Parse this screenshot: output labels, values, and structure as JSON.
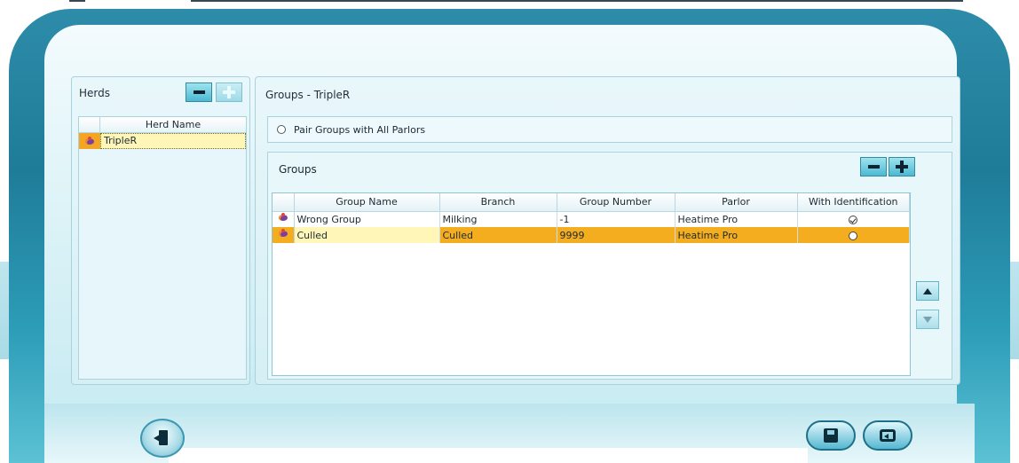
{
  "herds": {
    "title": "Herds",
    "remove_icon": "minus-icon",
    "add_icon": "plus-icon",
    "column_header": "Herd Name",
    "rows": [
      {
        "name": "TripleR",
        "icon": "cow-icon",
        "selected": true
      }
    ]
  },
  "groups_panel": {
    "title": "Groups - TripleR",
    "pair_option_label": "Pair Groups with All Parlors",
    "pair_option_checked": false
  },
  "groups": {
    "title": "Groups",
    "remove_icon": "minus-icon",
    "add_icon": "plus-icon",
    "columns": [
      "Group Name",
      "Branch",
      "Group Number",
      "Parlor",
      "With Identification"
    ],
    "rows": [
      {
        "name": "Wrong Group",
        "branch": "Milking",
        "number": "-1",
        "parlor": "Heatime Pro",
        "with_identification": true,
        "selected": false
      },
      {
        "name": "Culled",
        "branch": "Culled",
        "number": "9999",
        "parlor": "Heatime Pro",
        "with_identification": false,
        "selected": true
      }
    ],
    "move_up_icon": "arrow-up-icon",
    "move_down_icon": "arrow-down-icon"
  },
  "footer": {
    "exit_icon": "exit-door-icon",
    "save_icon": "save-floppy-icon",
    "back_icon": "back-return-icon"
  },
  "colors": {
    "selection_orange": "#f4ad1e",
    "selection_yellow": "#fff6b8",
    "frame_teal": "#1f7c99"
  }
}
